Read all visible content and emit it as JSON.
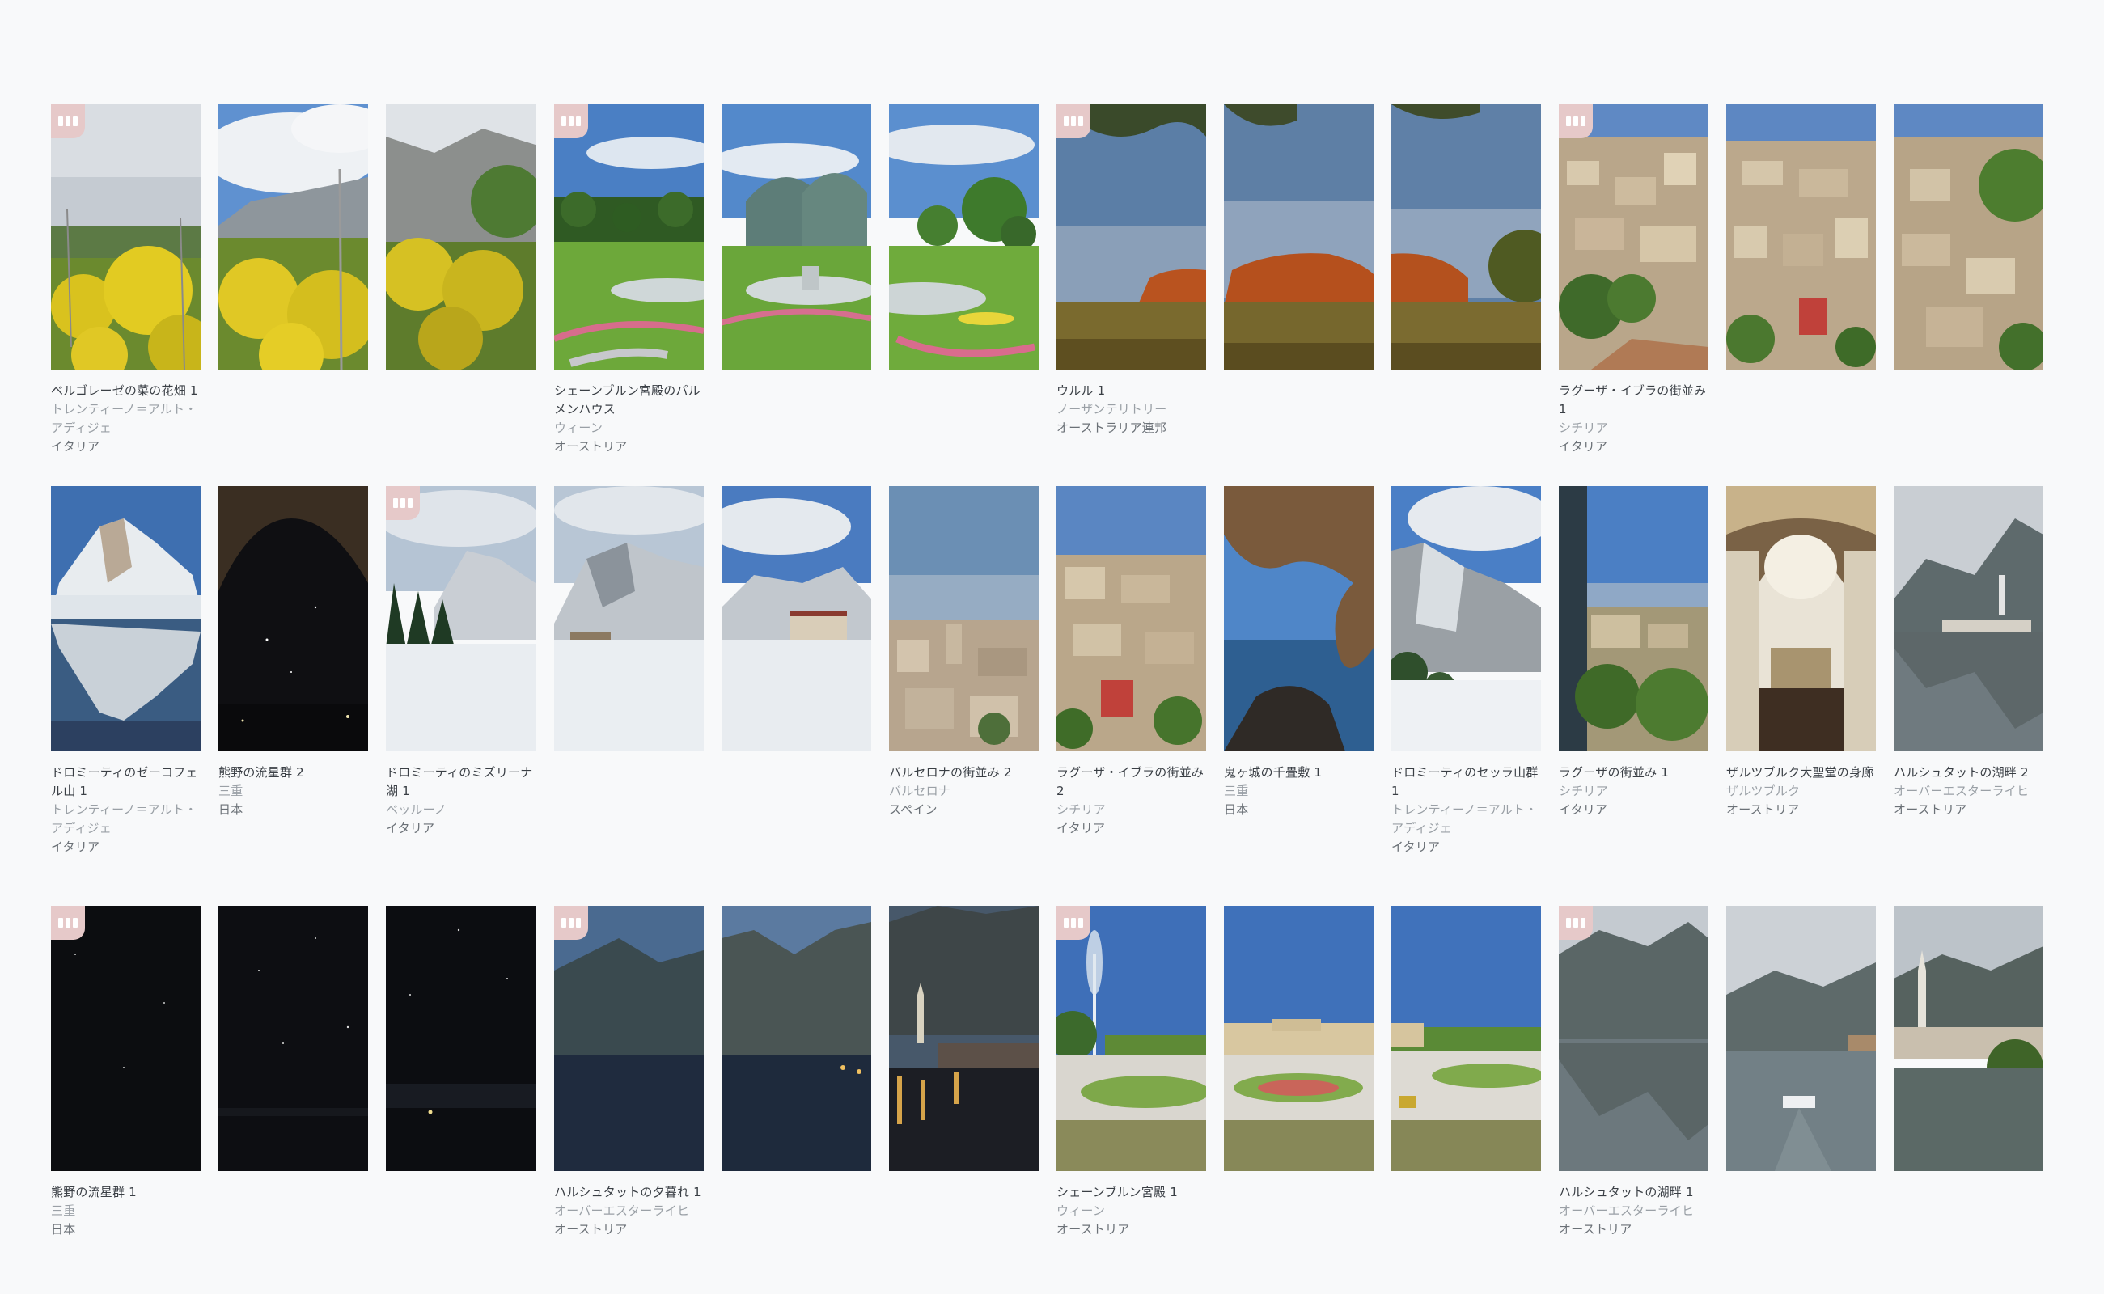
{
  "colors": {
    "background": "#f8f9fa",
    "badge": "#e6c9c9",
    "title_text": "#3a3f45",
    "region_text": "#9aa0a6",
    "country_text": "#6b7177"
  },
  "badge_icon": "film-strip-icon",
  "groups": [
    {
      "title": "ベルゴレーゼの菜の花畑 1",
      "region": "トレンティーノ＝アルト・アディジェ",
      "country": "イタリア"
    },
    {
      "title": "シェーンブルン宮殿のパルメンハウス",
      "region": "ウィーン",
      "country": "オーストリア"
    },
    {
      "title": "ウルル 1",
      "region": "ノーザンテリトリー",
      "country": "オーストラリア連邦"
    },
    {
      "title": "ラグーザ・イブラの街並み 1",
      "region": "シチリア",
      "country": "イタリア"
    },
    {
      "title": "ドロミーティのゼーコフェル山 1",
      "region": "トレンティーノ＝アルト・アディジェ",
      "country": "イタリア"
    },
    {
      "title": "熊野の流星群 2",
      "region": "三重",
      "country": "日本"
    },
    {
      "title": "ドロミーティのミズリーナ湖 1",
      "region": "ベッルーノ",
      "country": "イタリア"
    },
    {
      "title": "バルセロナの街並み 2",
      "region": "バルセロナ",
      "country": "スペイン"
    },
    {
      "title": "ラグーザ・イブラの街並み 2",
      "region": "シチリア",
      "country": "イタリア"
    },
    {
      "title": "鬼ヶ城の千畳敷 1",
      "region": "三重",
      "country": "日本"
    },
    {
      "title": "ドロミーティのセッラ山群 1",
      "region": "トレンティーノ＝アルト・アディジェ",
      "country": "イタリア"
    },
    {
      "title": "ラグーザの街並み 1",
      "region": "シチリア",
      "country": "イタリア"
    },
    {
      "title": "ザルツブルク大聖堂の身廊",
      "region": "ザルツブルク",
      "country": "オーストリア"
    },
    {
      "title": "ハルシュタットの湖畔 2",
      "region": "オーバーエスターライヒ",
      "country": "オーストリア"
    },
    {
      "title": "熊野の流星群 1",
      "region": "三重",
      "country": "日本"
    },
    {
      "title": "ハルシュタットの夕暮れ 1",
      "region": "オーバーエスターライヒ",
      "country": "オーストリア"
    },
    {
      "title": "シェーンブルン宮殿 1",
      "region": "ウィーン",
      "country": "オーストリア"
    },
    {
      "title": "ハルシュタットの湖畔 1",
      "region": "オーバーエスターライヒ",
      "country": "オーストリア"
    }
  ]
}
